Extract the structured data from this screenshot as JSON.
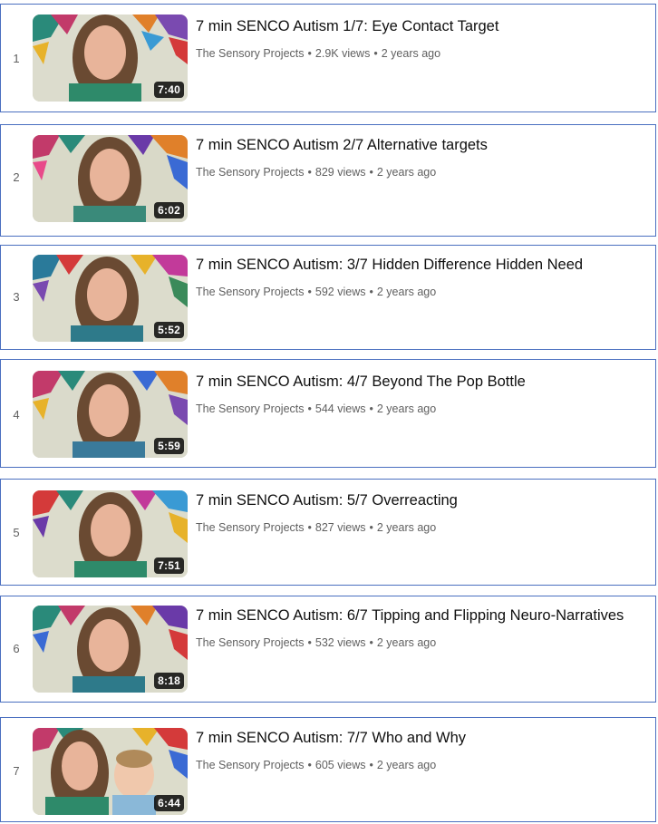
{
  "colors": {
    "border": "#4a6fc0",
    "title_text": "#0f0f0f",
    "meta_text": "#606060",
    "duration_bg": "#000000",
    "duration_text": "#ffffff"
  },
  "playlist": {
    "items": [
      {
        "index": "1",
        "title": "7 min SENCO Autism 1/7: Eye Contact Target",
        "channel": "The Sensory Projects",
        "views": "2.9K views",
        "age": "2 years ago",
        "duration": "7:40"
      },
      {
        "index": "2",
        "title": "7 min SENCO Autism 2/7 Alternative targets",
        "channel": "The Sensory Projects",
        "views": "829 views",
        "age": "2 years ago",
        "duration": "6:02"
      },
      {
        "index": "3",
        "title": "7 min SENCO Autism: 3/7 Hidden Difference Hidden Need",
        "channel": "The Sensory Projects",
        "views": "592 views",
        "age": "2 years ago",
        "duration": "5:52"
      },
      {
        "index": "4",
        "title": "7 min SENCO Autism: 4/7 Beyond The Pop Bottle",
        "channel": "The Sensory Projects",
        "views": "544 views",
        "age": "2 years ago",
        "duration": "5:59"
      },
      {
        "index": "5",
        "title": "7 min SENCO Autism: 5/7 Overreacting",
        "channel": "The Sensory Projects",
        "views": "827 views",
        "age": "2 years ago",
        "duration": "7:51"
      },
      {
        "index": "6",
        "title": "7 min SENCO Autism: 6/7 Tipping and Flipping Neuro-Narratives",
        "channel": "The Sensory Projects",
        "views": "532 views",
        "age": "2 years ago",
        "duration": "8:18"
      },
      {
        "index": "7",
        "title": "7 min SENCO Autism: 7/7 Who and Why",
        "channel": "The Sensory Projects",
        "views": "605 views",
        "age": "2 years ago",
        "duration": "6:44"
      }
    ]
  }
}
